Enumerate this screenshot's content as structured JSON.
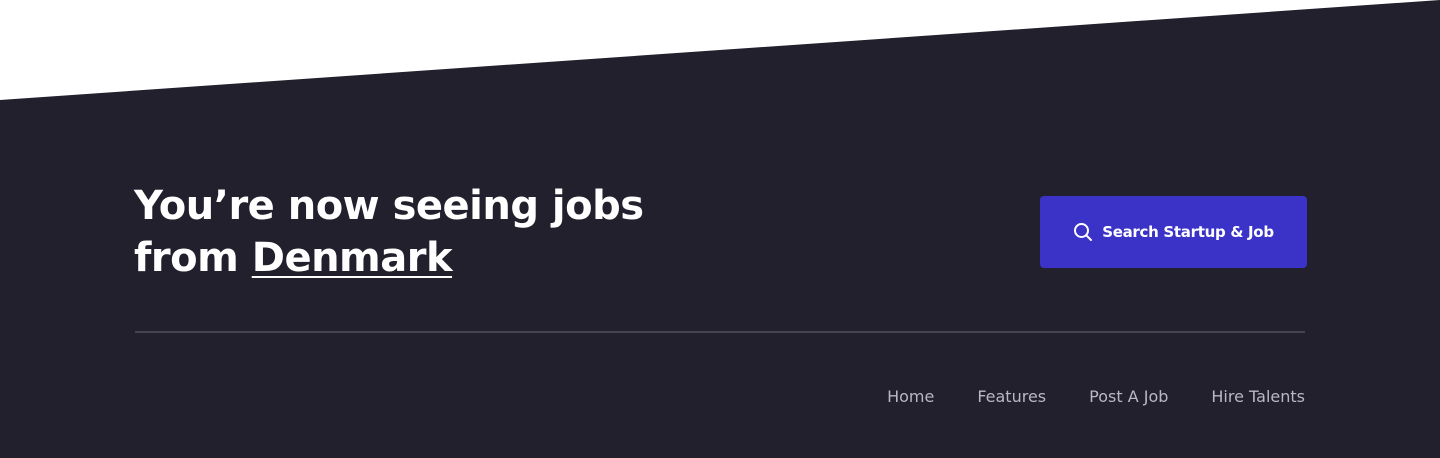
{
  "banner": {
    "headline_line1": "You’re now seeing jobs",
    "headline_prefix": "from",
    "country": "Denmark"
  },
  "search_button": {
    "label": "Search Startup & Job",
    "icon": "search-icon"
  },
  "footer_nav": {
    "home": "Home",
    "features": "Features",
    "post_job": "Post A Job",
    "hire_talents": "Hire Talents"
  },
  "colors": {
    "background_dark": "#22202c",
    "background_light": "#ffffff",
    "accent": "#3b33c7",
    "divider": "#454452",
    "nav_text": "#b9b7c4",
    "headline_text": "#ffffff"
  }
}
